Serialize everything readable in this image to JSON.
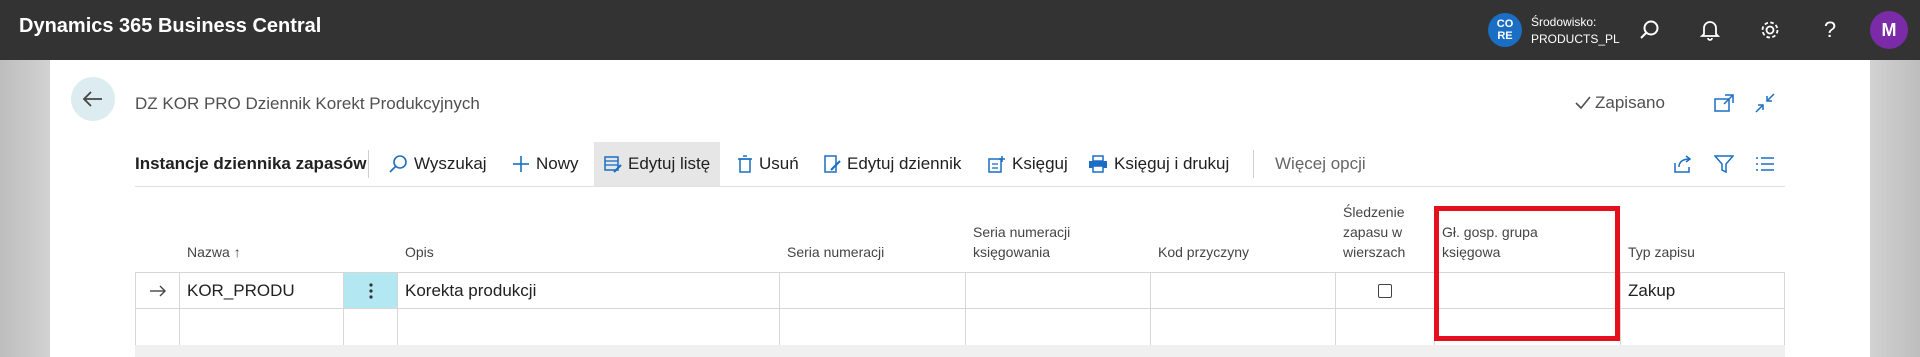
{
  "topbar": {
    "app_title": "Dynamics 365 Business Central",
    "env_badge_line1": "CO",
    "env_badge_line2": "RE",
    "env_label": "Środowisko:",
    "env_value": "PRODUCTS_PL",
    "avatar_initial": "M",
    "icons": [
      "search-icon",
      "bell-icon",
      "gear-icon",
      "help-icon"
    ]
  },
  "page": {
    "title": "DZ KOR PRO Dziennik Korekt Produkcyjnych",
    "status": "Zapisano"
  },
  "actions": {
    "context_title": "Instancje dziennika zapasów",
    "search": "Wyszukaj",
    "new": "Nowy",
    "edit_list": "Edytuj listę",
    "delete": "Usuń",
    "edit_journal": "Edytuj dziennik",
    "post": "Księguj",
    "post_print": "Księguj i drukuj",
    "more": "Więcej opcji"
  },
  "columns": {
    "name": "Nazwa",
    "sort_indicator": "↑",
    "description": "Opis",
    "no_series": "Seria numeracji",
    "posting_no_series_1": "Seria numeracji",
    "posting_no_series_2": "księgowania",
    "reason_code": "Kod przyczyny",
    "item_tracking_1": "Śledzenie",
    "item_tracking_2": "zapasu w",
    "item_tracking_3": "wierszach",
    "gen_bus_posting_group_1": "Gł. gosp. grupa",
    "gen_bus_posting_group_2": "księgowa",
    "entry_type": "Typ zapisu"
  },
  "rows": [
    {
      "name": "KOR_PRODU",
      "description": "Korekta produkcji",
      "no_series": "",
      "posting_no_series": "",
      "reason_code": "",
      "item_tracking": false,
      "gen_bus_posting_group": "",
      "entry_type": "Zakup"
    }
  ],
  "colors": {
    "topbar": "#333333",
    "accent": "#1a6fc4",
    "avatar": "#7b2aa8",
    "highlight": "#e4101e",
    "kebab_bg": "#b3e8f2"
  }
}
